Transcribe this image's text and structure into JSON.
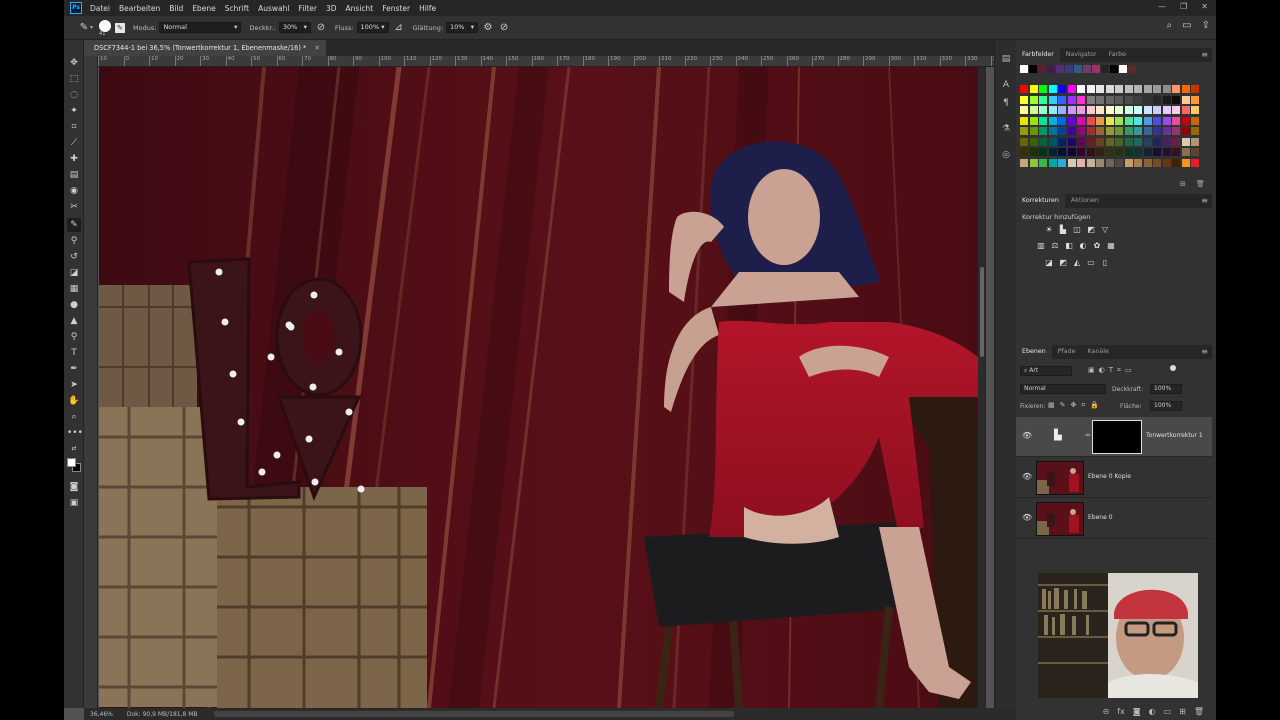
{
  "menubar": {
    "app_badge": "Ps",
    "items": [
      "Datei",
      "Bearbeiten",
      "Bild",
      "Ebene",
      "Schrift",
      "Auswahl",
      "Filter",
      "3D",
      "Ansicht",
      "Fenster",
      "Hilfe"
    ]
  },
  "options": {
    "brush_size": "41",
    "modus_label": "Modus:",
    "modus_value": "Normal",
    "deckkraft_label": "Deckkr.:",
    "deckkraft_value": "30%",
    "fluss_label": "Fluss:",
    "fluss_value": "100%",
    "glaettung_label": "Glättung:",
    "glaettung_value": "10%"
  },
  "document": {
    "tab_title": "DSCF7344-1 bei 36,5% (Tonwertkorrektur 1, Ebenenmaske/16) *",
    "ruler_ticks": [
      "10",
      "0",
      "10",
      "20",
      "30",
      "40",
      "50",
      "60",
      "70",
      "80",
      "90",
      "100",
      "110",
      "120",
      "130",
      "140",
      "150",
      "160",
      "170",
      "180",
      "190",
      "200",
      "210",
      "220",
      "230",
      "240",
      "250",
      "260",
      "270",
      "280",
      "290",
      "300",
      "310",
      "320",
      "330",
      "340"
    ]
  },
  "status": {
    "zoom": "36,46%",
    "doc_info": "Dok: 90,9 MB/181,8 MB"
  },
  "swatches_panel": {
    "tabs": [
      "Farbfelder",
      "Navigator",
      "Farbe"
    ],
    "active_tab": "Farbfelder",
    "recent_colors": [
      "#ffffff",
      "#000000",
      "#5a1f33",
      "#3b1e4a",
      "#55307a",
      "#3b3b7a",
      "#2f5a8a",
      "#6a3d6a",
      "#993366",
      "#2a1f2a",
      "#000000",
      "#ffffff",
      "#5a2a2a"
    ],
    "grid_rows": [
      [
        "#ff0000",
        "#ffff00",
        "#00ff00",
        "#00ffff",
        "#0000ff",
        "#ff00ff",
        "#ffffff",
        "#f2f2f2",
        "#e6e6e6",
        "#d9d9d9",
        "#cccccc",
        "#bfbfbf",
        "#b3b3b3",
        "#a6a6a6",
        "#999999",
        "#8c8c8c",
        "#ff9966",
        "#ff6600",
        "#cc3300"
      ],
      [
        "#ffff33",
        "#99ff33",
        "#33ff99",
        "#33ccff",
        "#3366ff",
        "#9933ff",
        "#ff33cc",
        "#7f7f7f",
        "#737373",
        "#666666",
        "#595959",
        "#4d4d4d",
        "#404040",
        "#333333",
        "#262626",
        "#1a1a1a",
        "#0d0d0d",
        "#ffcc99",
        "#ff9933"
      ],
      [
        "#ffff99",
        "#ccff99",
        "#99ffcc",
        "#99e6ff",
        "#99b3ff",
        "#cc99ff",
        "#ff99e6",
        "#ffcccc",
        "#ffe6cc",
        "#ffffcc",
        "#e6ffcc",
        "#ccffe6",
        "#ccffff",
        "#cce6ff",
        "#ccccff",
        "#e6ccff",
        "#ffcce6",
        "#ff6666",
        "#ffcc66"
      ],
      [
        "#e6e600",
        "#99e600",
        "#00e699",
        "#00b3e6",
        "#0066e6",
        "#6600e6",
        "#e600b3",
        "#e64d4d",
        "#e69a4d",
        "#e6e64d",
        "#9ae64d",
        "#4de69a",
        "#4de6e6",
        "#4d9ae6",
        "#4d4de6",
        "#9a4de6",
        "#e64d9a",
        "#cc0000",
        "#cc6600"
      ],
      [
        "#999900",
        "#669900",
        "#009966",
        "#007799",
        "#004499",
        "#440099",
        "#990077",
        "#993333",
        "#996633",
        "#999933",
        "#669933",
        "#339966",
        "#339999",
        "#336699",
        "#333399",
        "#663399",
        "#993366",
        "#990000",
        "#996600"
      ],
      [
        "#666600",
        "#336600",
        "#006633",
        "#005566",
        "#002266",
        "#220066",
        "#660055",
        "#662222",
        "#664422",
        "#666622",
        "#446622",
        "#226644",
        "#226666",
        "#224466",
        "#222266",
        "#442266",
        "#662244",
        "#d9c9b3",
        "#b39473"
      ],
      [
        "#333300",
        "#1a3300",
        "#00331a",
        "#002233",
        "#001133",
        "#110033",
        "#33002a",
        "#331111",
        "#332211",
        "#333311",
        "#223311",
        "#113322",
        "#113333",
        "#112233",
        "#111133",
        "#221133",
        "#331122",
        "#8c6d4f",
        "#5e4530"
      ],
      [
        "#c9a57a",
        "#8dc63f",
        "#39b54a",
        "#00a99d",
        "#29abe2",
        "#d9c9b3",
        "#e6b3a6",
        "#c7b299",
        "#998675",
        "#736357",
        "#534741",
        "#c69c6d",
        "#a67c52",
        "#8c6239",
        "#754c24",
        "#603913",
        "#42210b",
        "#f7941d",
        "#ed1c24"
      ]
    ]
  },
  "adjustments_panel": {
    "tabs": [
      "Korrekturen",
      "Aktionen"
    ],
    "active_tab": "Korrekturen",
    "heading": "Korrektur hinzufügen"
  },
  "layers_panel": {
    "tabs": [
      "Ebenen",
      "Pfade",
      "Kanäle"
    ],
    "active_tab": "Ebenen",
    "filter_kind": "Art",
    "blend_mode": "Normal",
    "opacity_label": "Deckkraft:",
    "opacity_value": "100%",
    "lock_label": "Fixieren:",
    "fill_label": "Fläche:",
    "fill_value": "100%",
    "layers": [
      {
        "name": "Tonwertkorrektur 1",
        "visible": true,
        "selected": true
      },
      {
        "name": "Ebene 0 Kopie",
        "visible": true,
        "selected": false
      },
      {
        "name": "Ebene 0",
        "visible": true,
        "selected": false
      }
    ]
  }
}
